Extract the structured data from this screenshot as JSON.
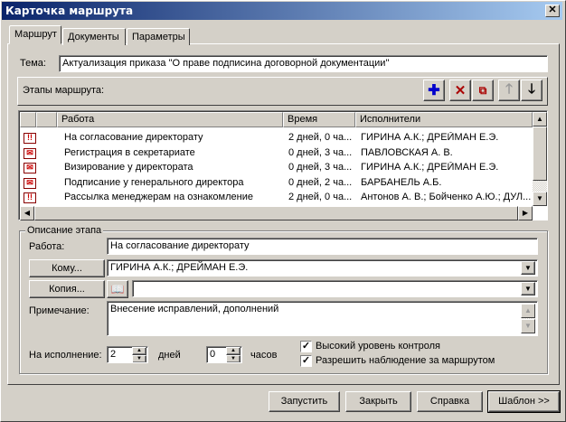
{
  "window": {
    "title": "Карточка маршрута",
    "close": "✕"
  },
  "tabs": [
    {
      "label": "Маршрут",
      "selected": true
    },
    {
      "label": "Документы"
    },
    {
      "label": "Параметры"
    }
  ],
  "subject": {
    "label": "Тема:",
    "value": "Актуализация приказа \"О праве подписина договорной документации\""
  },
  "stages": {
    "label": "Этапы маршрута:",
    "toolbar": [
      "add-stage-icon",
      "delete-icon",
      "copy-icon",
      "move-up-icon",
      "move-down-icon"
    ]
  },
  "table": {
    "headers": [
      "",
      "",
      "Работа",
      "Время",
      "Исполнители"
    ],
    "rows": [
      {
        "icon": "!!",
        "work": "На согласование директорату",
        "time": "2 дней, 0 ча...",
        "performers": "ГИРИНА  А.К.; ДРЕЙМАН  Е.Э."
      },
      {
        "icon": "✉",
        "work": "Регистрация в секретариате",
        "time": "0 дней, 3 ча...",
        "performers": "ПАВЛОВСКАЯ А. В."
      },
      {
        "icon": "✉",
        "work": "Визирование у директората",
        "time": "0 дней, 3 ча...",
        "performers": "ГИРИНА  А.К.; ДРЕЙМАН  Е.Э."
      },
      {
        "icon": "✉",
        "work": "Подписание у генерального директора",
        "time": "0 дней, 2 ча...",
        "performers": "БАРБАНЕЛЬ  А.Б."
      },
      {
        "icon": "!!",
        "work": "Рассылка менеджерам на ознакомление",
        "time": "2 дней, 0 ча...",
        "performers": "Антонов А. В.; Бойченко А.Ю.; ДУЛ..."
      }
    ]
  },
  "desc": {
    "legend": "Описание этапа",
    "work_label": "Работа:",
    "work_value": "На согласование директорату",
    "to_button": "Кому...",
    "to_value": "ГИРИНА  А.К.; ДРЕЙМАН  Е.Э.",
    "copy_button": "Копия...",
    "copy_value": "",
    "note_label": "Примечание:",
    "note_value": "Внесение исправлений, дополнений",
    "exec_label": "На исполнение:",
    "days_value": "2",
    "days_label": "дней",
    "hours_value": "0",
    "hours_label": "часов",
    "check1": "Высокий  уровень контроля",
    "check2": "Разрешить наблюдение за маршрутом"
  },
  "buttons": {
    "start": "Запустить",
    "close": "Закрыть",
    "help": "Справка",
    "template": "Шаблон >>"
  }
}
